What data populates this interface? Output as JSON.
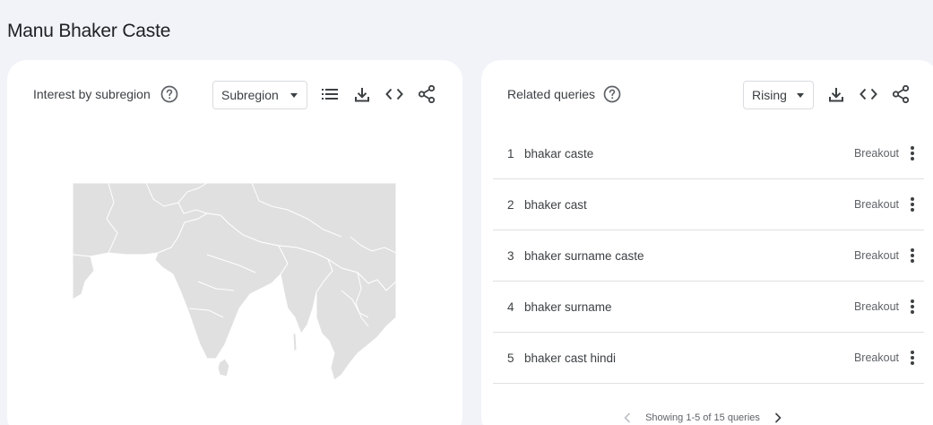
{
  "page": {
    "title": "Manu Bhaker Caste"
  },
  "interest_panel": {
    "title": "Interest by subregion",
    "select_value": "Subregion",
    "icons": [
      "help-icon",
      "list-view-icon",
      "download-icon",
      "embed-code-icon",
      "share-icon"
    ]
  },
  "related_panel": {
    "title": "Related queries",
    "select_value": "Rising",
    "icons": [
      "help-icon",
      "download-icon",
      "embed-code-icon",
      "share-icon"
    ],
    "queries": [
      {
        "rank": "1",
        "text": "bhakar caste",
        "value": "Breakout"
      },
      {
        "rank": "2",
        "text": "bhaker cast",
        "value": "Breakout"
      },
      {
        "rank": "3",
        "text": "bhaker surname caste",
        "value": "Breakout"
      },
      {
        "rank": "4",
        "text": "bhaker surname",
        "value": "Breakout"
      },
      {
        "rank": "5",
        "text": "bhaker cast hindi",
        "value": "Breakout"
      }
    ],
    "pagination": "Showing 1-5 of 15 queries"
  },
  "colors": {
    "background": "#f1f3f8",
    "card": "#ffffff",
    "map_land": "#e0e0e0",
    "map_border": "#ffffff",
    "text": "#3c4043"
  }
}
